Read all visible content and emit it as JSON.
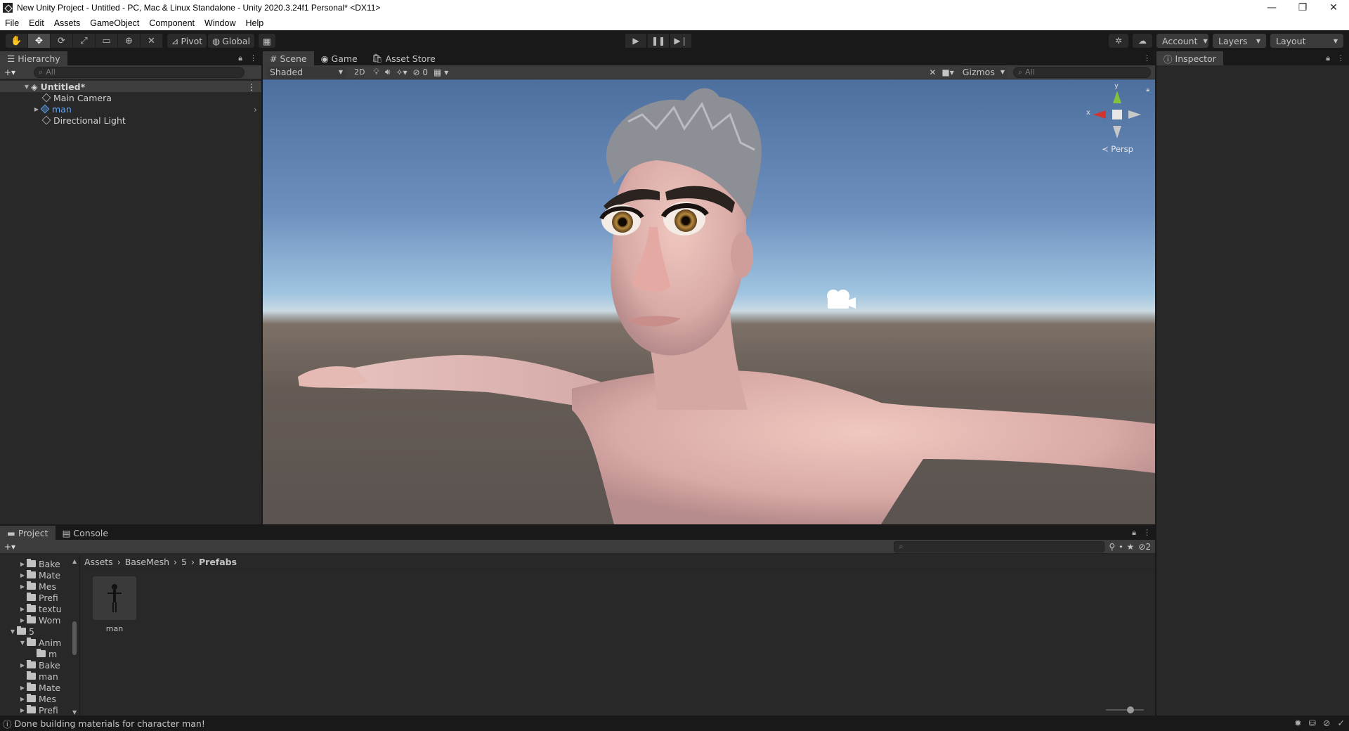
{
  "window": {
    "title": "New Unity Project - Untitled - PC, Mac & Linux Standalone - Unity 2020.3.24f1 Personal* <DX11>",
    "minimize": "—",
    "restore": "❐",
    "close": "✕"
  },
  "menu": [
    "File",
    "Edit",
    "Assets",
    "GameObject",
    "Component",
    "Window",
    "Help"
  ],
  "toolbar": {
    "pivot": "Pivot",
    "global": "Global",
    "account": "Account",
    "layers": "Layers",
    "layout": "Layout"
  },
  "hierarchy": {
    "tab": "Hierarchy",
    "search_placeholder": "All",
    "scene": "Untitled*",
    "items": [
      "Main Camera",
      "man",
      "Directional Light"
    ]
  },
  "scene_tabs": [
    "Scene",
    "Game",
    "Asset Store"
  ],
  "scene_toolbar": {
    "shading": "Shaded",
    "mode_2d": "2D",
    "hidden_count": "0",
    "gizmos": "Gizmos",
    "search_placeholder": "All",
    "persp": "Persp",
    "axis_x": "x",
    "axis_y": "y"
  },
  "inspector": {
    "tab": "Inspector"
  },
  "project": {
    "tabs": [
      "Project",
      "Console"
    ],
    "tree": [
      {
        "label": "Bake",
        "indent": 2,
        "arrow": true
      },
      {
        "label": "Mate",
        "indent": 2,
        "arrow": true
      },
      {
        "label": "Mes",
        "indent": 2,
        "arrow": true
      },
      {
        "label": "Prefi",
        "indent": 2,
        "arrow": false
      },
      {
        "label": "textu",
        "indent": 2,
        "arrow": true
      },
      {
        "label": "Wom",
        "indent": 2,
        "arrow": true
      },
      {
        "label": "5",
        "indent": 1,
        "arrow": true,
        "open": true
      },
      {
        "label": "Anim",
        "indent": 2,
        "arrow": true,
        "open": true
      },
      {
        "label": "m",
        "indent": 3,
        "arrow": false
      },
      {
        "label": "Bake",
        "indent": 2,
        "arrow": true
      },
      {
        "label": "man",
        "indent": 2,
        "arrow": false
      },
      {
        "label": "Mate",
        "indent": 2,
        "arrow": true
      },
      {
        "label": "Mes",
        "indent": 2,
        "arrow": true
      },
      {
        "label": "Prefi",
        "indent": 2,
        "arrow": true
      }
    ],
    "breadcrumb": [
      "Assets",
      "BaseMesh",
      "5",
      "Prefabs"
    ],
    "asset_name": "man",
    "hidden_count": "2"
  },
  "status": {
    "message": "Done building materials for character man!"
  },
  "colors": {
    "selection_blue": "#5ea8ff",
    "panel": "#282828",
    "dark": "#191919"
  }
}
